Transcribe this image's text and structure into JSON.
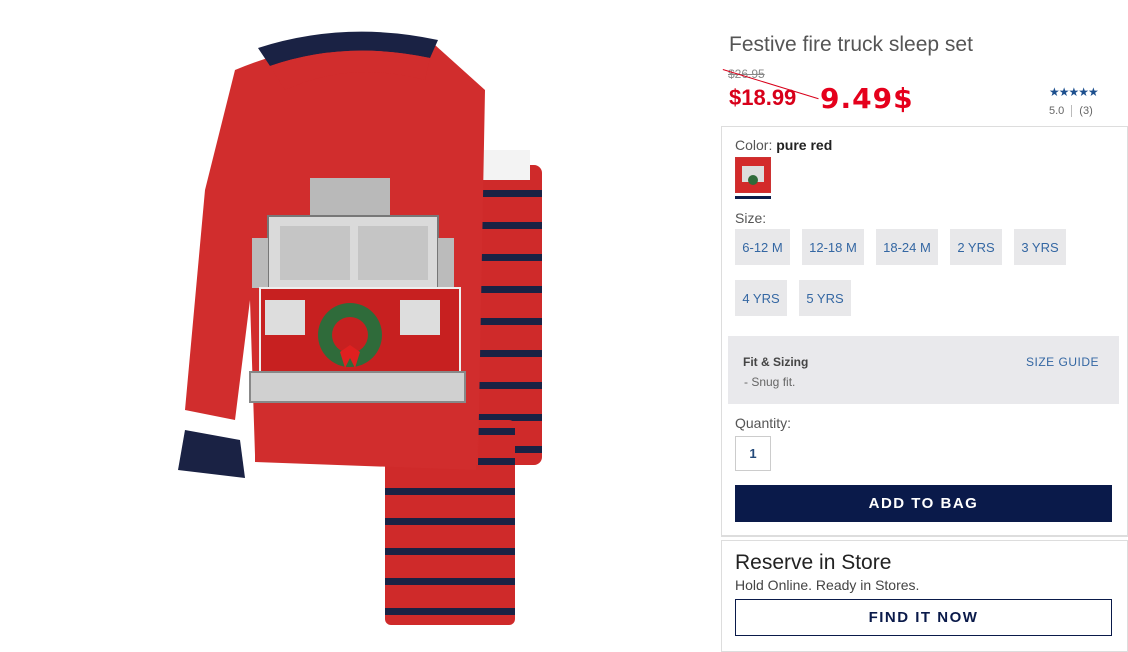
{
  "product": {
    "title": "Festive fire truck sleep set",
    "original_price": "$26.95",
    "sale_price": "$18.99",
    "handwritten_price": "9.49$",
    "rating": {
      "stars": "★★★★★",
      "score": "5.0",
      "count": "(3)"
    }
  },
  "color": {
    "label": "Color:",
    "value": "pure red"
  },
  "size": {
    "label": "Size:",
    "options": [
      "6-12 M",
      "12-18 M",
      "18-24 M",
      "2 YRS",
      "3 YRS",
      "4 YRS",
      "5 YRS"
    ]
  },
  "fit": {
    "title": "Fit & Sizing",
    "guide_link": "SIZE GUIDE",
    "note": "- Snug fit."
  },
  "quantity": {
    "label": "Quantity:",
    "value": "1"
  },
  "buttons": {
    "add_to_bag": "ADD TO BAG",
    "find_it_now": "FIND IT NOW"
  },
  "reserve": {
    "title": "Reserve in Store",
    "subtitle": "Hold Online. Ready in Stores."
  },
  "colors": {
    "accent_navy": "#0a1a4a",
    "sale_red": "#d8001a",
    "link_blue": "#3467a3"
  }
}
